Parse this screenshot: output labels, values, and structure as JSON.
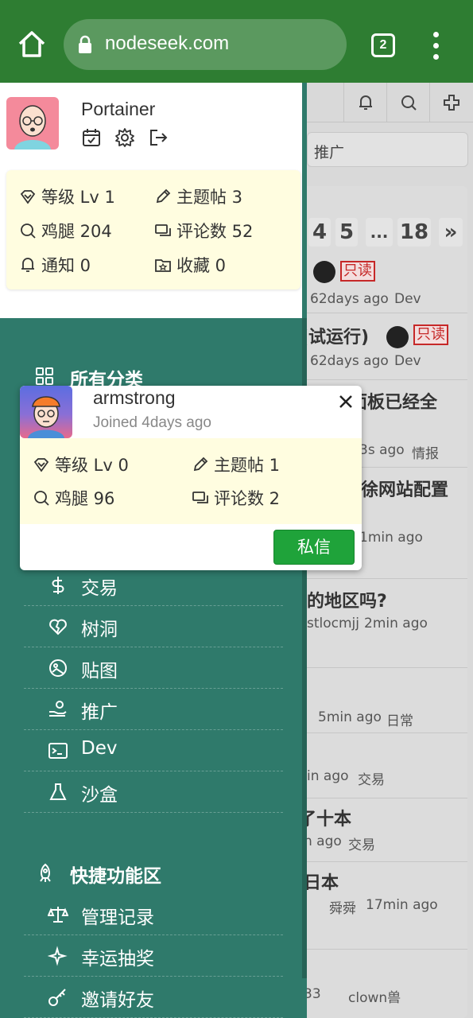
{
  "browser": {
    "url": "nodeseek.com",
    "tab_count": "2"
  },
  "background_page": {
    "search_placeholder": "推广",
    "pagination": [
      "4",
      "5",
      "...",
      "18",
      "»"
    ],
    "posts": [
      {
        "title": "",
        "meta": "62days ago",
        "category": "Dev",
        "badge": "只读"
      },
      {
        "title": "(试运行)",
        "meta": "62days ago",
        "category": "Dev",
        "badge": "只读"
      },
      {
        "title": "面板已经全",
        "meta": "3s ago",
        "category": "情报"
      },
      {
        "title": "徐网站配置",
        "meta": "1min ago",
        "category": ""
      },
      {
        "title": "的地区吗?",
        "meta": "stlocmjj",
        "meta2": "2min ago"
      },
      {
        "title": "",
        "meta": "5min ago",
        "category": "日常"
      },
      {
        "title": "",
        "meta": "in ago",
        "category": "交易"
      },
      {
        "title": "了十本",
        "meta": "n ago",
        "category": "交易"
      },
      {
        "title": "日本",
        "meta": "舜舜",
        "meta2": "17min ago"
      },
      {
        "title": "",
        "meta": "33",
        "meta2": "clown兽"
      }
    ]
  },
  "me": {
    "name": "Portainer",
    "stats": {
      "level": "等级 Lv 1",
      "topics": "主题帖 3",
      "chicken": "鸡腿 204",
      "comments": "评论数 52",
      "notifications": "通知 0",
      "favorites": "收藏 0"
    }
  },
  "drawer": {
    "all_categories": "所有分类",
    "quick_section": "快捷功能区",
    "categories": [
      "交易",
      "树洞",
      "贴图",
      "推广",
      "Dev",
      "沙盒"
    ],
    "quick_items": [
      "管理记录",
      "幸运抽奖",
      "邀请好友"
    ]
  },
  "popup": {
    "name": "armstrong",
    "joined": "Joined 4days ago",
    "stats": {
      "level": "等级 Lv 0",
      "topics": "主题帖 1",
      "chicken": "鸡腿 96",
      "comments": "评论数 2"
    },
    "pm_label": "私信"
  }
}
